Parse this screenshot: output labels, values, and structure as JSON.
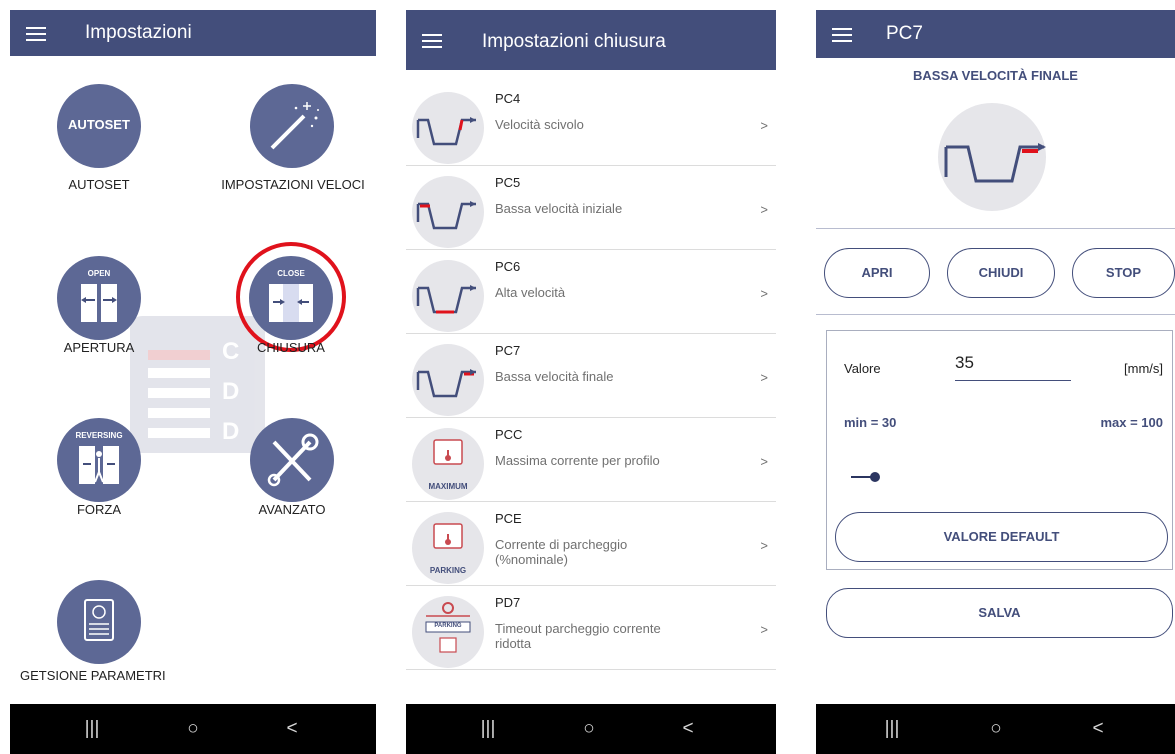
{
  "screen1": {
    "title": "Impostazioni",
    "items": [
      {
        "label": "AUTOSET",
        "icon_text": "AUTOSET"
      },
      {
        "label": "IMPOSTAZIONI VELOCI"
      },
      {
        "label": "APERTURA",
        "icon_text": "OPEN"
      },
      {
        "label": "CHIUSURA",
        "icon_text": "CLOSE"
      },
      {
        "label": "FORZA",
        "icon_text": "REVERSING"
      },
      {
        "label": "AVANZATO"
      },
      {
        "label": "GETSIONE PARAMETRI"
      }
    ],
    "watermark": [
      "C",
      "D",
      "D"
    ]
  },
  "screen2": {
    "title": "Impostazioni chiusura",
    "rows": [
      {
        "code": "PC4",
        "desc": "Velocità scivolo",
        "chev": ">"
      },
      {
        "code": "PC5",
        "desc": "Bassa velocità iniziale",
        "chev": ">"
      },
      {
        "code": "PC6",
        "desc": "Alta velocità",
        "chev": ">"
      },
      {
        "code": "PC7",
        "desc": "Bassa velocità finale",
        "chev": ">"
      },
      {
        "code": "PCC",
        "desc": "Massima corrente per profilo",
        "chev": ">",
        "badge": "MAXIMUM"
      },
      {
        "code": "PCE",
        "desc": "Corrente di parcheggio (%nominale)",
        "chev": ">",
        "badge": "PARKING"
      },
      {
        "code": "PD7",
        "desc": "Timeout parcheggio corrente ridotta",
        "chev": ">",
        "badge": "PARKING"
      }
    ]
  },
  "screen3": {
    "title": "PC7",
    "subtitle": "BASSA VELOCITÀ FINALE",
    "buttons": {
      "open": "APRI",
      "close": "CHIUDI",
      "stop": "STOP"
    },
    "value_label": "Valore",
    "value": "35",
    "unit": "[mm/s]",
    "min": "min = 30",
    "max": "max = 100",
    "slider_fraction": 0.07,
    "default_button": "VALORE DEFAULT",
    "save_button": "SALVA"
  },
  "navbar": {
    "recents": "|||",
    "home": "○",
    "back": "<"
  },
  "colors": {
    "primary": "#434e7b",
    "icon_bg": "#5d6895",
    "accent_red": "#e0121c"
  }
}
